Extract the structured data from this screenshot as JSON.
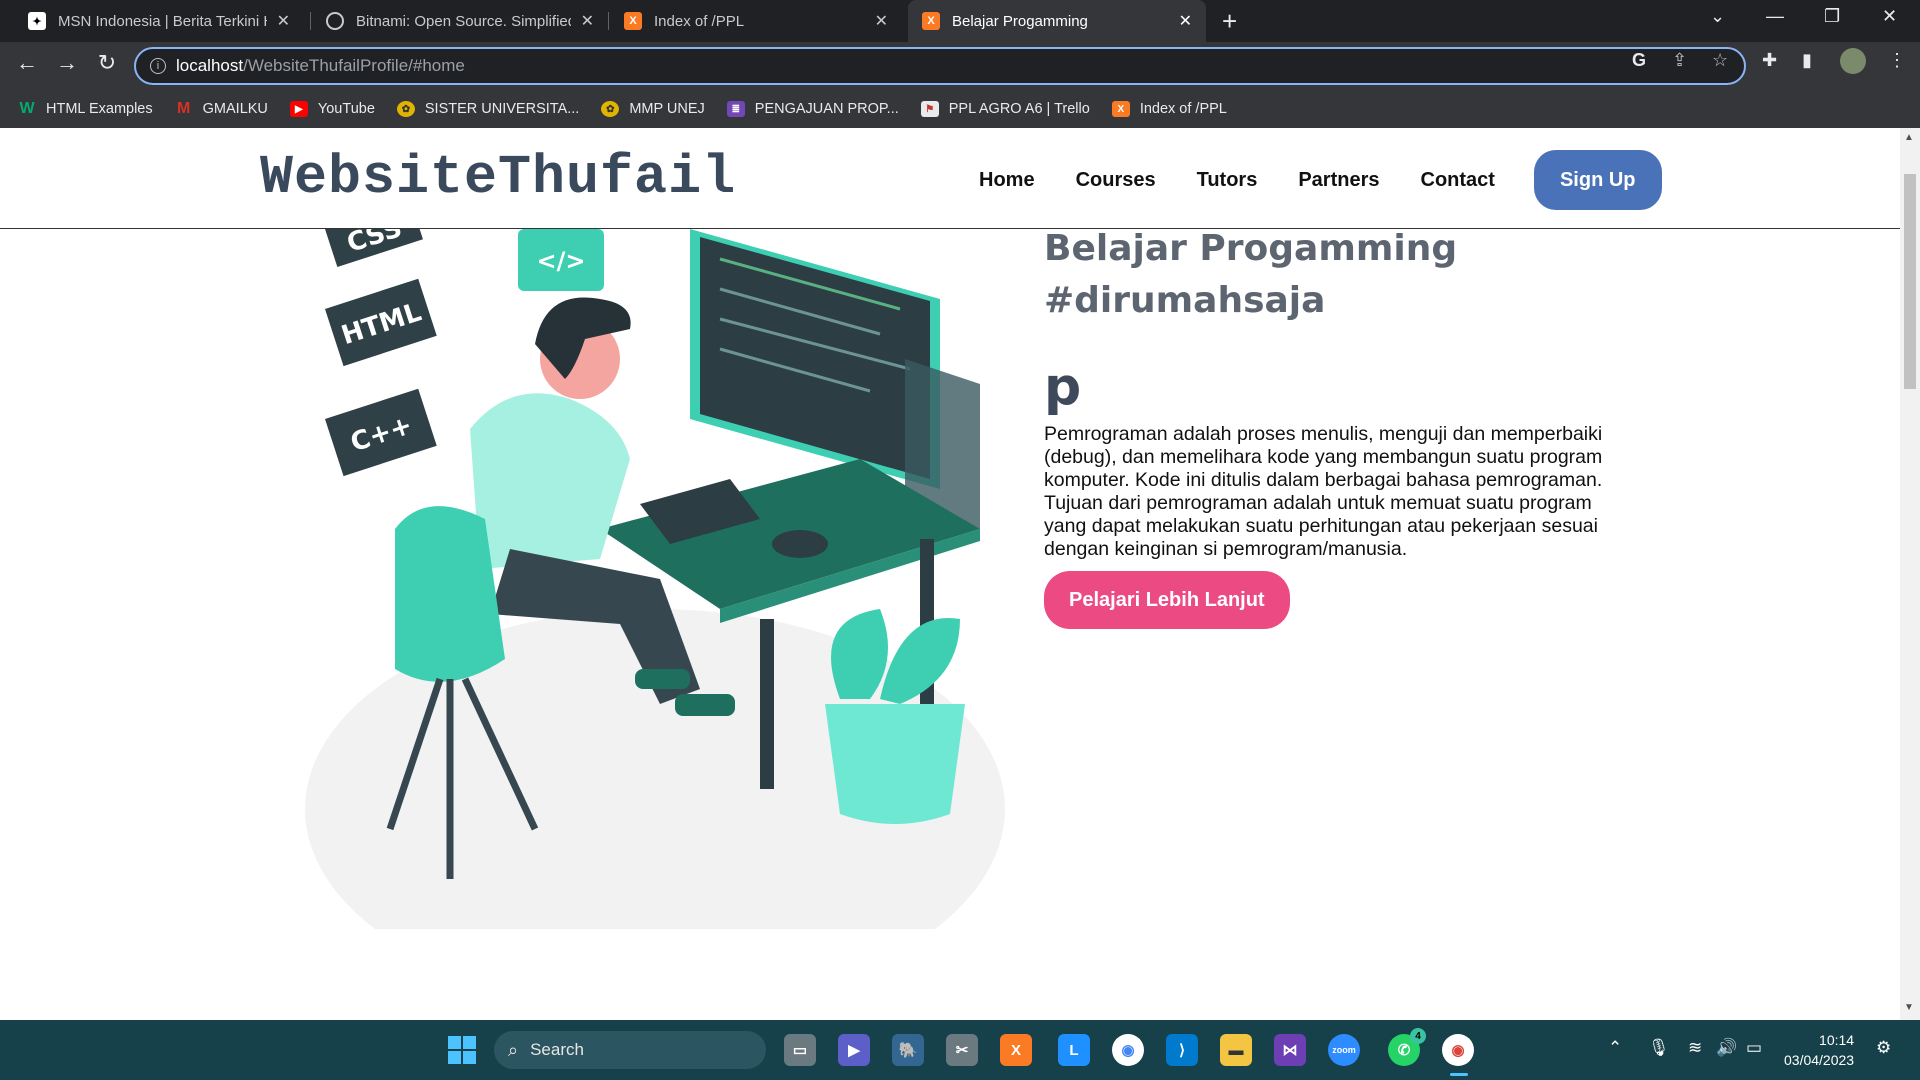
{
  "browser": {
    "tabs": [
      {
        "title": "MSN Indonesia | Berita Terkini Ha",
        "icon": "msn-icon",
        "active": false
      },
      {
        "title": "Bitnami: Open Source. Simplified",
        "icon": "globe-icon",
        "active": false
      },
      {
        "title": "Index of /PPL",
        "icon": "xampp-icon",
        "active": false
      },
      {
        "title": "Belajar Progamming",
        "icon": "xampp-icon",
        "active": true
      }
    ],
    "new_tab": "+",
    "url_host": "localhost",
    "url_path": "/WebsiteThufailProfile/#home",
    "bookmarks": [
      {
        "label": "HTML Examples",
        "icon": "w3schools-icon",
        "color": "#04aa6d"
      },
      {
        "label": "GMAILKU",
        "icon": "gmail-icon",
        "color": "#d93025"
      },
      {
        "label": "YouTube",
        "icon": "youtube-icon",
        "color": "#ff0000"
      },
      {
        "label": "SISTER UNIVERSITA...",
        "icon": "university-seal-icon",
        "color": "#e0b400"
      },
      {
        "label": "MMP UNEJ",
        "icon": "university-seal-icon",
        "color": "#e0b400"
      },
      {
        "label": "PENGAJUAN PROP...",
        "icon": "forms-icon",
        "color": "#7248b9"
      },
      {
        "label": "PPL AGRO A6 | Trello",
        "icon": "trello-icon",
        "color": "#e8eaed"
      },
      {
        "label": "Index of /PPL",
        "icon": "xampp-icon",
        "color": "#fb7a24"
      }
    ]
  },
  "site": {
    "logo": "WebsiteThufail",
    "nav": [
      "Home",
      "Courses",
      "Tutors",
      "Partners",
      "Contact"
    ],
    "signup": "Sign Up",
    "hero": {
      "title_line1": "Belajar Progamming",
      "title_line2": "#dirumahsaja",
      "p_heading": "p",
      "body": "Pemrograman adalah proses menulis, menguji dan memperbaiki (debug), dan memelihara kode yang membangun suatu program komputer. Kode ini ditulis dalam berbagai bahasa pemrograman. Tujuan dari pemrograman adalah untuk memuat suatu program yang dapat melakukan suatu perhitungan atau pekerjaan sesuai dengan keinginan si pemrogram/manusia.",
      "cta": "Pelajari Lebih Lanjut",
      "art_labels": [
        "CSS",
        "HTML",
        "C++",
        "</>"
      ]
    },
    "colors": {
      "signup": "#4a72b8",
      "cta": "#ec4a82",
      "accent": "#3ecfb2",
      "logo": "#3a4a5c"
    }
  },
  "taskbar": {
    "search_placeholder": "Search",
    "whatsapp_badge": "4",
    "time": "10:14",
    "date": "03/04/2023"
  }
}
